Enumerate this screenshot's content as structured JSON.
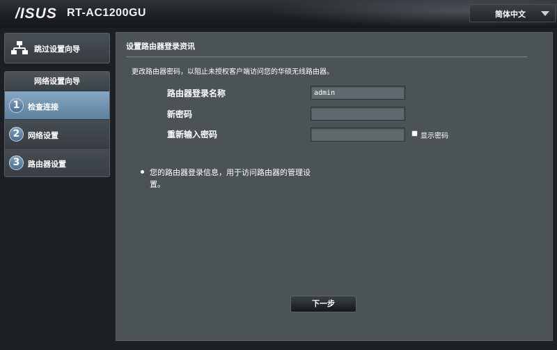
{
  "header": {
    "brand": "/ISUS",
    "model": "RT-AC1200GU",
    "language": "简体中文"
  },
  "sidebar": {
    "skip_label": "跳过设置向导",
    "wizard_title": "网络设置向导",
    "steps": [
      {
        "number": "1",
        "label": "检查连接",
        "active": true
      },
      {
        "number": "2",
        "label": "网络设置",
        "active": false
      },
      {
        "number": "3",
        "label": "路由器设置",
        "active": false
      }
    ]
  },
  "main": {
    "title": "设置路由器登录资讯",
    "description": "更改路由器密码，以阻止未授权客户端访问您的华硕无线路由器。",
    "fields": [
      {
        "label": "路由器登录名称",
        "value": "admin"
      },
      {
        "label": "新密码",
        "value": ""
      },
      {
        "label": "重新输入密码",
        "value": ""
      }
    ],
    "show_password_label": "显示密码",
    "note": "您的路由器登录信息，用于访问路由器的管理设置。",
    "next_label": "下一步"
  },
  "colors": {
    "background": "#1c2024",
    "panel": "#4b5357",
    "active_step": "#6f92b0",
    "input": "#5f6a6e"
  }
}
